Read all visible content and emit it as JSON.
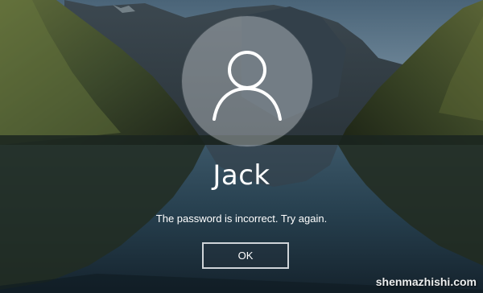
{
  "login": {
    "user_name": "Jack",
    "error_message": "The password is incorrect. Try again.",
    "ok_label": "OK"
  },
  "icons": {
    "avatar": "user-silhouette-icon"
  },
  "watermark": {
    "text": "shenmazhishi.com"
  },
  "colors": {
    "text": "#ffffff",
    "button_border": "#cfd4d8",
    "avatar_fill": "#cdd2d6"
  }
}
